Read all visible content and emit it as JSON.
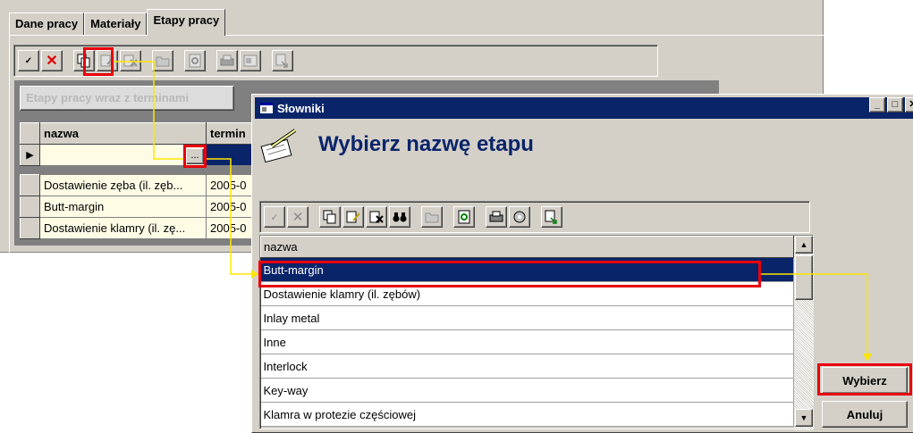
{
  "main": {
    "tabs": [
      "Dane pracy",
      "Materiały",
      "Etapy pracy"
    ],
    "grid_caption": "Etapy pracy wraz z terminami",
    "columns": [
      "nazwa",
      "termin"
    ],
    "ellipsis_label": "...",
    "rows": [
      [
        "Dostawienie zęba (il. zęb...",
        "2005-0"
      ],
      [
        "Butt-margin",
        "2005-0"
      ],
      [
        "Dostawienie klamry (il. zę...",
        "2005-0"
      ]
    ]
  },
  "dialog": {
    "title": "Słowniki",
    "heading": "Wybierz nazwę etapu",
    "column_header": "nazwa",
    "items": [
      "Butt-margin",
      "Dostawienie klamry (il. zębów)",
      "Inlay metal",
      "Inne",
      "Interlock",
      "Key-way",
      "Klamra w protezie częściowej"
    ],
    "selected_index": 0,
    "select_button": "Wybierz",
    "cancel_button": "Anuluj"
  },
  "colors": {
    "titlebar": "#0a246a",
    "highlight": "#e8000c",
    "arrow": "#ffe600",
    "row_bg": "#fffce6"
  }
}
